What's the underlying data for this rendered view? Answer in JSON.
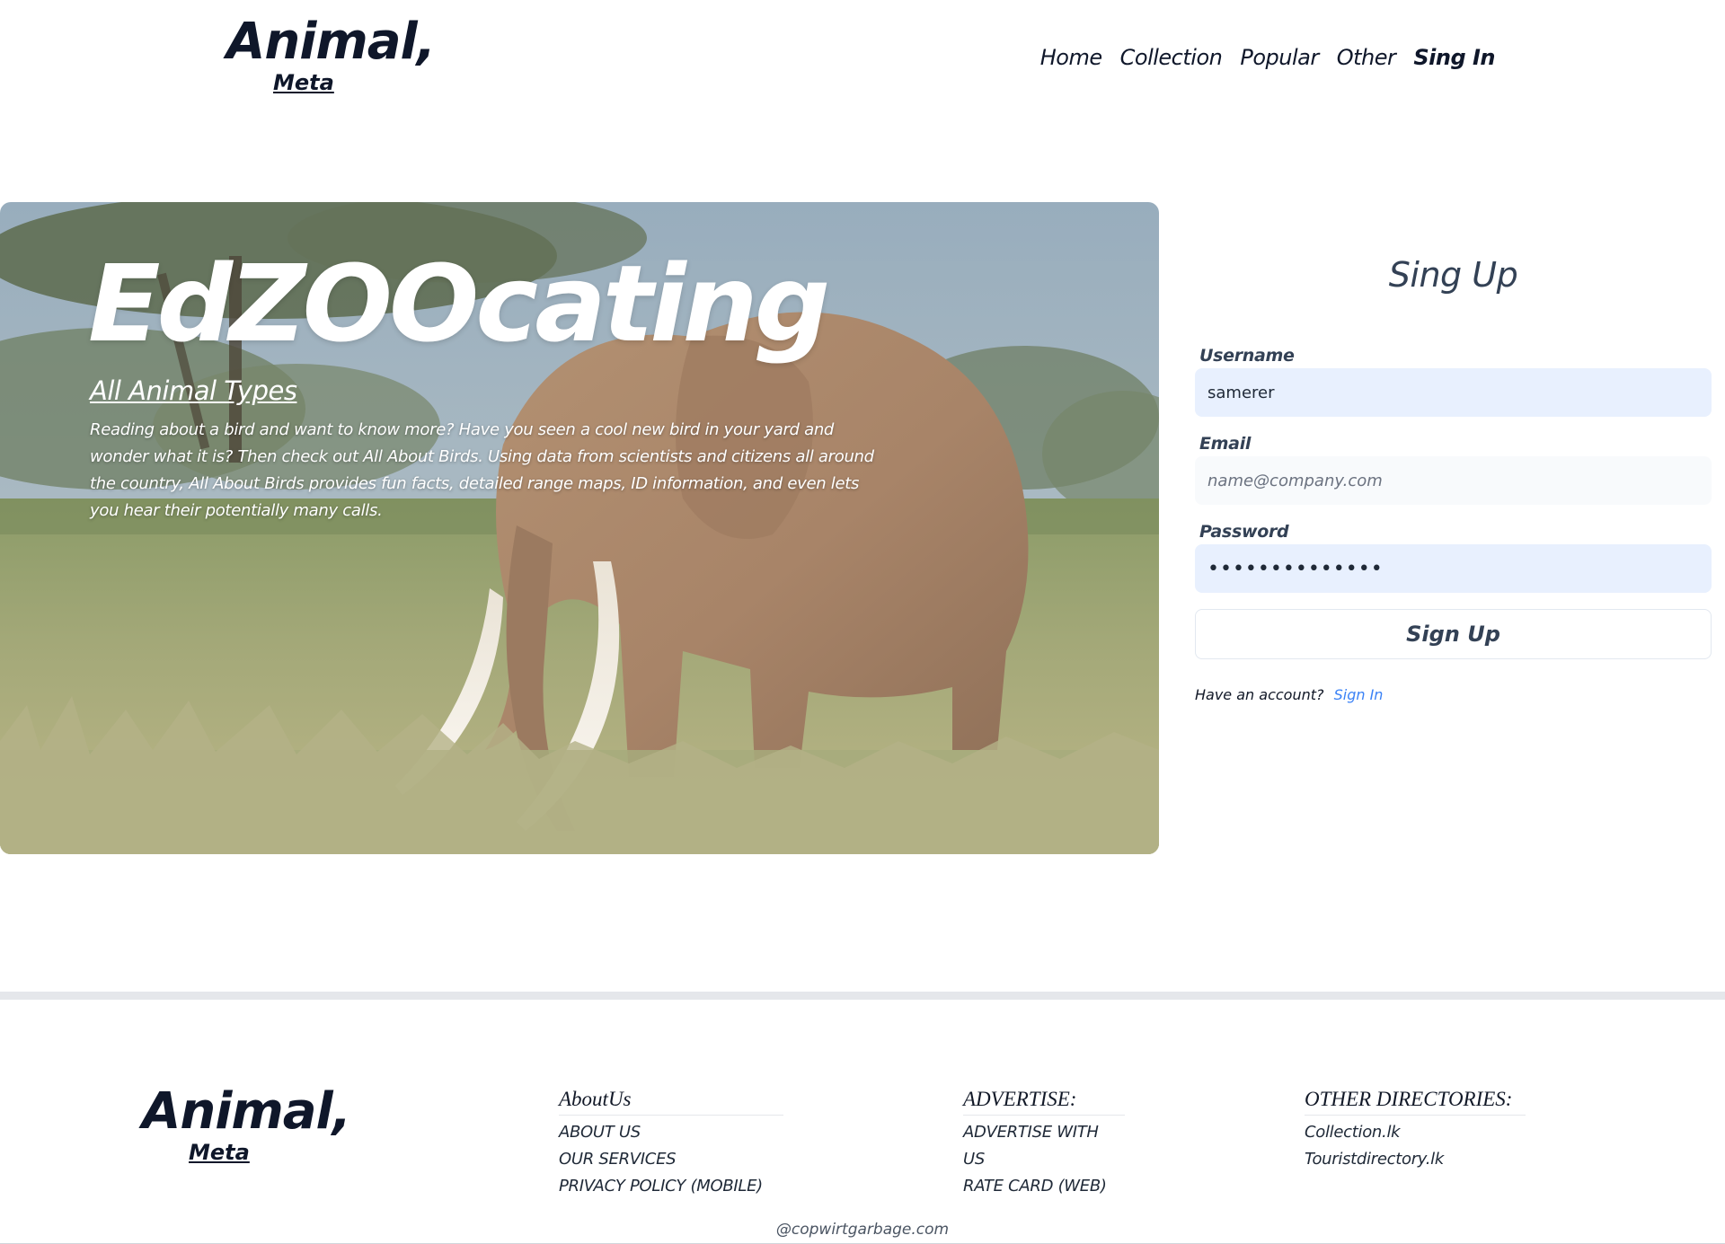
{
  "header": {
    "logo_title": "Animal,",
    "logo_subtitle": "Meta",
    "nav": [
      "Home",
      "Collection",
      "Popular",
      "Other",
      "Sing In"
    ]
  },
  "hero": {
    "title": "EdZOOcating",
    "subtitle": "All Animal Types",
    "text": "Reading about a bird and want to know more? Have you seen a cool new bird in your yard and wonder what it is? Then check out All About Birds. Using data from scientists and citizens all around the country, All About Birds provides fun facts, detailed range maps, ID information, and even lets you hear their potentially many calls."
  },
  "signup": {
    "heading": "Sing Up",
    "username_label": "Username",
    "username_value": "samerer",
    "email_label": "Email",
    "email_placeholder": "name@company.com",
    "password_label": "Password",
    "password_value": "••••••••••••••",
    "submit_label": "Sign Up",
    "have_account": "Have an account?",
    "signin_link": "Sign In"
  },
  "footer": {
    "logo_title": "Animal,",
    "logo_subtitle": "Meta",
    "about": {
      "heading": "AboutUs",
      "links": [
        "ABOUT US",
        "OUR SERVICES",
        "PRIVACY POLICY (MOBILE)"
      ]
    },
    "advertise": {
      "heading": "ADVERTISE:",
      "links": [
        "ADVERTISE WITH US",
        "RATE CARD (WEB)"
      ]
    },
    "other": {
      "heading": "OTHER DIRECTORIES:",
      "links": [
        "Collection.lk",
        "Touristdirectory.lk"
      ]
    },
    "copyright": "@copwirtgarbage.com"
  },
  "colors": {
    "navy": "#0f172a",
    "slate": "#334155",
    "link_blue": "#3b82f6",
    "input_autofill": "#e8f0fe",
    "footer_rule": "#e5e7eb"
  }
}
